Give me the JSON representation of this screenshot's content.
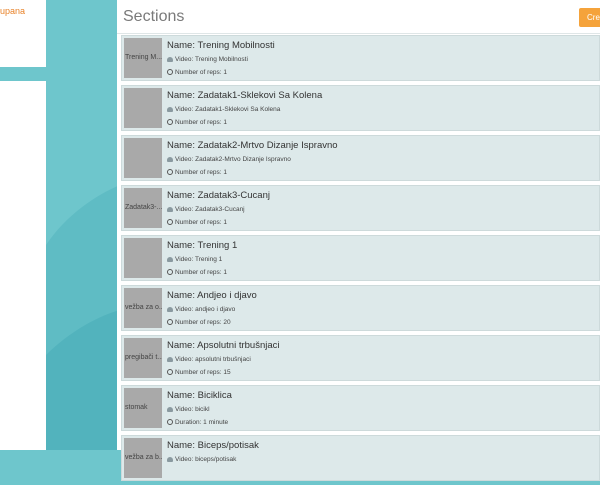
{
  "sidebar": {
    "user_text": "upana"
  },
  "header": {
    "title": "Sections",
    "create_label": "Crea"
  },
  "labels": {
    "name_prefix": "Name: ",
    "video_prefix": "Video: ",
    "reps_prefix": "Number of reps: ",
    "duration_prefix": "Duration: "
  },
  "sections": [
    {
      "thumb": "Trening M...",
      "name": "Trening Mobilnosti",
      "video": "Trening Mobilnosti",
      "metric": "Number of reps: 1"
    },
    {
      "thumb": "",
      "name": "Zadatak1-Sklekovi Sa Kolena",
      "video": "Zadatak1-Sklekovi Sa Kolena",
      "metric": "Number of reps: 1"
    },
    {
      "thumb": "",
      "name": "Zadatak2-Mrtvo Dizanje Ispravno",
      "video": "Zadatak2-Mrtvo Dizanje Ispravno",
      "metric": "Number of reps: 1"
    },
    {
      "thumb": "Zadatak3-...",
      "name": "Zadatak3-Cucanj",
      "video": "Zadatak3-Cucanj",
      "metric": "Number of reps: 1"
    },
    {
      "thumb": "",
      "name": "Trening 1",
      "video": "Trening 1",
      "metric": "Number of reps: 1"
    },
    {
      "thumb": "vežba za o...",
      "name": "Andjeo i djavo",
      "video": "andjeo i djavo",
      "metric": "Number of reps: 20"
    },
    {
      "thumb": "pregibači t...",
      "name": "Apsolutni trbušnjaci",
      "video": "apsolutni trbušnjaci",
      "metric": "Number of reps: 15"
    },
    {
      "thumb": "stomak",
      "name": "Biciklica",
      "video": "bicikl",
      "metric": "Duration: 1 minute"
    },
    {
      "thumb": "vežba za b...",
      "name": "Biceps/potisak",
      "video": "biceps/potisak",
      "metric": ""
    }
  ]
}
